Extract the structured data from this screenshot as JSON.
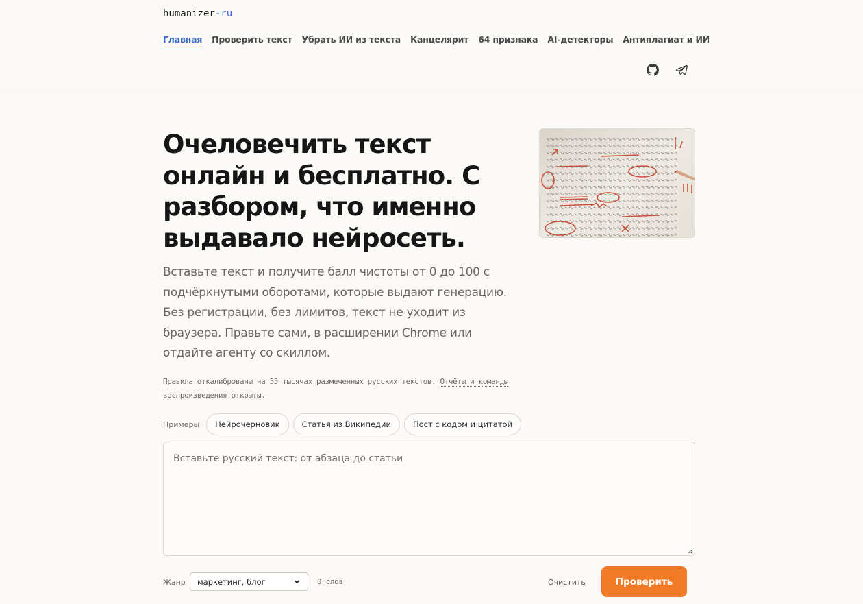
{
  "header": {
    "logo_main": "humanizer",
    "logo_accent": "-ru",
    "nav": [
      {
        "label": "Главная",
        "active": true
      },
      {
        "label": "Проверить текст"
      },
      {
        "label": "Убрать ИИ из текста"
      },
      {
        "label": "Канцелярит"
      },
      {
        "label": "64 признака"
      },
      {
        "label": "AI-детекторы"
      },
      {
        "label": "Антиплагиат и ИИ"
      }
    ],
    "icons": [
      "github-icon",
      "telegram-icon"
    ]
  },
  "hero": {
    "title": "Очеловечить текст онлайн и бесплатно. С разбором, что именно выдавало нейросеть.",
    "subtitle": "Вставьте текст и получите балл чистоты от 0 до 100 с подчёркнутыми оборотами, которые выдают генерацию. Без регистрации, без лимитов, текст не уходит из браузера. Правьте сами, в расширении Chrome или отдайте агенту со скиллом.",
    "note_text": "Правила откалиброваны на 55 тысячах размеченных русских текстов. ",
    "note_link": "Отчёты и команды воспроизведения открыты",
    "note_end": "."
  },
  "examples": {
    "label": "Примеры",
    "chips": [
      "Нейрочерновик",
      "Статья из Википедии",
      "Пост с кодом и цитатой"
    ]
  },
  "editor": {
    "placeholder": "Вставьте русский текст: от абзаца до статьи"
  },
  "controls": {
    "genre_label": "Жанр",
    "genre_value": "маркетинг, блог",
    "word_count": "0 слов",
    "clear_label": "Очистить",
    "check_label": "Проверить"
  },
  "colors": {
    "accent": "#3b68c6",
    "cta": "#f07a26",
    "background": "#fbfaf7"
  }
}
